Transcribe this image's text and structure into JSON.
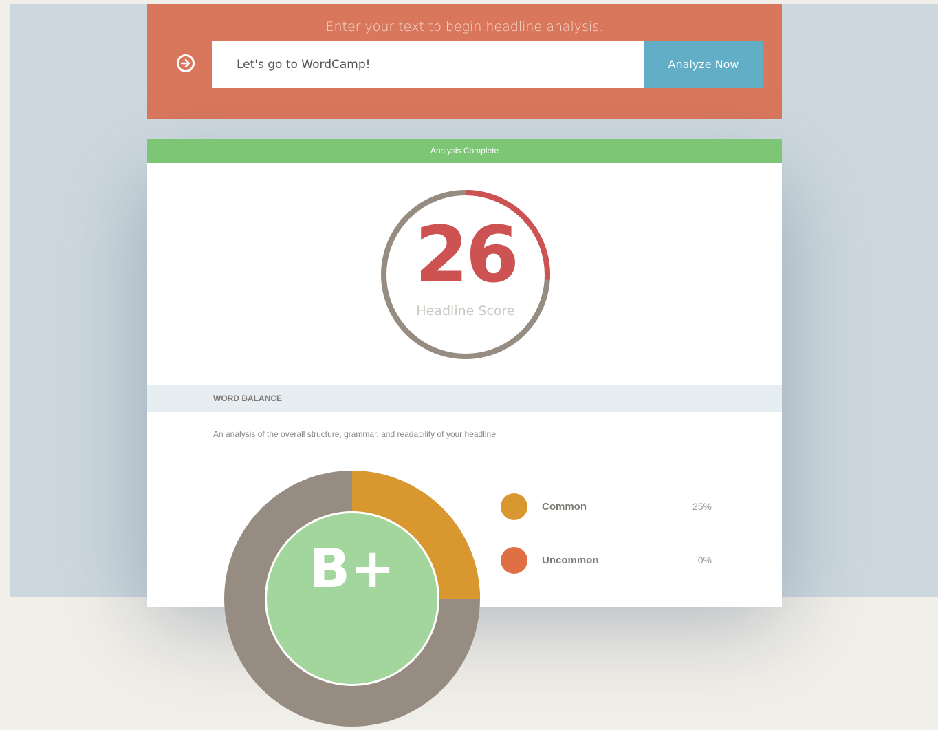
{
  "header": {
    "prompt": "Enter your text to begin headline analysis:",
    "input_value": "Let's go to WordCamp!",
    "analyze_label": "Analyze Now"
  },
  "status": {
    "text": "Analysis Complete"
  },
  "score": {
    "value": "26",
    "label": "Headline Score",
    "fraction": 0.26
  },
  "word_balance": {
    "title": "WORD BALANCE",
    "description": "An analysis of the overall structure, grammar, and readability of your headline.",
    "grade": "B+",
    "legend": [
      {
        "label": "Common",
        "value": "25%",
        "color": "#d9972f"
      },
      {
        "label": "Uncommon",
        "value": "0%",
        "color": "#df6f45"
      }
    ]
  },
  "colors": {
    "header_bg": "#d8775c",
    "accent_blue": "#62aec7",
    "status_green": "#7dc676",
    "score_red": "#cd5353",
    "ring_gray": "#968c82",
    "grade_green": "#a3d69c"
  },
  "icons": {
    "submit": "arrow-right-circle-icon"
  }
}
